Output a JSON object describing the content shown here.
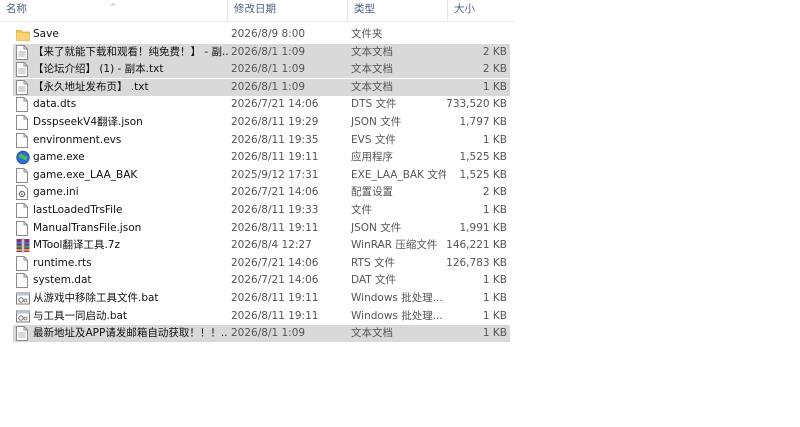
{
  "columns": {
    "name": "名称",
    "date": "修改日期",
    "type": "类型",
    "size": "大小"
  },
  "files": [
    {
      "name": "Save",
      "date": "2026/8/9 8:00",
      "type": "文件夹",
      "size": "",
      "icon": "folder-icon",
      "selected": false
    },
    {
      "name": "【来了就能下载和观看！纯免费！】 - 副...",
      "date": "2026/8/1 1:09",
      "type": "文本文档",
      "size": "2 KB",
      "icon": "text-file-icon",
      "selected": true
    },
    {
      "name": "【论坛介绍】 (1) - 副本.txt",
      "date": "2026/8/1 1:09",
      "type": "文本文档",
      "size": "2 KB",
      "icon": "text-file-icon",
      "selected": true
    },
    {
      "name": "【永久地址发布页】 .txt",
      "date": "2026/8/1 1:09",
      "type": "文本文档",
      "size": "1 KB",
      "icon": "text-file-icon",
      "selected": true
    },
    {
      "name": "data.dts",
      "date": "2026/7/21 14:06",
      "type": "DTS 文件",
      "size": "733,520 KB",
      "icon": "file-icon",
      "selected": false
    },
    {
      "name": "DsspseekV4翻译.json",
      "date": "2026/8/11 19:29",
      "type": "JSON 文件",
      "size": "1,797 KB",
      "icon": "file-icon",
      "selected": false
    },
    {
      "name": "environment.evs",
      "date": "2026/8/11 19:35",
      "type": "EVS 文件",
      "size": "1 KB",
      "icon": "file-icon",
      "selected": false
    },
    {
      "name": "game.exe",
      "date": "2026/8/11 19:11",
      "type": "应用程序",
      "size": "1,525 KB",
      "icon": "app-exe-icon",
      "selected": false
    },
    {
      "name": "game.exe_LAA_BAK",
      "date": "2025/9/12 17:31",
      "type": "EXE_LAA_BAK 文件",
      "size": "1,525 KB",
      "icon": "file-icon",
      "selected": false
    },
    {
      "name": "game.ini",
      "date": "2026/7/21 14:06",
      "type": "配置设置",
      "size": "2 KB",
      "icon": "settings-file-icon",
      "selected": false
    },
    {
      "name": "lastLoadedTrsFile",
      "date": "2026/8/11 19:33",
      "type": "文件",
      "size": "1 KB",
      "icon": "file-icon",
      "selected": false
    },
    {
      "name": "ManualTransFile.json",
      "date": "2026/8/11 19:11",
      "type": "JSON 文件",
      "size": "1,991 KB",
      "icon": "file-icon",
      "selected": false
    },
    {
      "name": "MTool翻译工具.7z",
      "date": "2026/8/4 12:27",
      "type": "WinRAR 压缩文件",
      "size": "146,221 KB",
      "icon": "winrar-archive-icon",
      "selected": false
    },
    {
      "name": "runtime.rts",
      "date": "2026/7/21 14:06",
      "type": "RTS 文件",
      "size": "126,783 KB",
      "icon": "file-icon",
      "selected": false
    },
    {
      "name": "system.dat",
      "date": "2026/7/21 14:06",
      "type": "DAT 文件",
      "size": "1 KB",
      "icon": "file-icon",
      "selected": false
    },
    {
      "name": "从游戏中移除工具文件.bat",
      "date": "2026/8/11 19:11",
      "type": "Windows 批处理...",
      "size": "1 KB",
      "icon": "batch-file-icon",
      "selected": false
    },
    {
      "name": "与工具一同启动.bat",
      "date": "2026/8/11 19:11",
      "type": "Windows 批处理...",
      "size": "1 KB",
      "icon": "batch-file-icon",
      "selected": false
    },
    {
      "name": "最新地址及APP请发邮箱自动获取！！！...",
      "date": "2026/8/1 1:09",
      "type": "文本文档",
      "size": "1 KB",
      "icon": "text-file-icon",
      "selected": true
    }
  ]
}
